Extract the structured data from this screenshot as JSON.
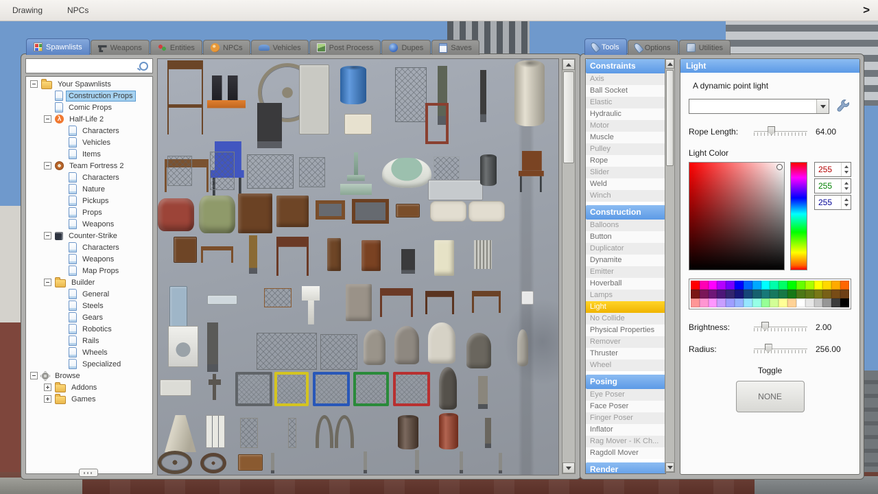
{
  "menubar": {
    "items": [
      "Drawing",
      "NPCs"
    ],
    "chevron": ">"
  },
  "left_tabs": [
    {
      "label": "Spawnlists",
      "icon": "spawnlists",
      "active": true
    },
    {
      "label": "Weapons",
      "icon": "weapons"
    },
    {
      "label": "Entities",
      "icon": "entities"
    },
    {
      "label": "NPCs",
      "icon": "npcs"
    },
    {
      "label": "Vehicles",
      "icon": "vehicles"
    },
    {
      "label": "Post Process",
      "icon": "postprocess"
    },
    {
      "label": "Dupes",
      "icon": "dupes"
    },
    {
      "label": "Saves",
      "icon": "saves"
    }
  ],
  "right_tabs": [
    {
      "label": "Tools",
      "icon": "wrench",
      "active": true
    },
    {
      "label": "Options",
      "icon": "wrench"
    },
    {
      "label": "Utilities",
      "icon": "utilities"
    }
  ],
  "sidebar": {
    "search_value": "",
    "tree": [
      {
        "label": "Your Spawnlists",
        "depth": 0,
        "icon": "folder",
        "expander": "minus"
      },
      {
        "label": "Construction Props",
        "depth": 1,
        "icon": "page",
        "selected": true
      },
      {
        "label": "Comic Props",
        "depth": 1,
        "icon": "page"
      },
      {
        "label": "Half-Life 2",
        "depth": 1,
        "icon": "hl2",
        "expander": "minus"
      },
      {
        "label": "Characters",
        "depth": 2,
        "icon": "page"
      },
      {
        "label": "Vehicles",
        "depth": 2,
        "icon": "page"
      },
      {
        "label": "Items",
        "depth": 2,
        "icon": "page"
      },
      {
        "label": "Team Fortress 2",
        "depth": 1,
        "icon": "tf2",
        "expander": "minus"
      },
      {
        "label": "Characters",
        "depth": 2,
        "icon": "page"
      },
      {
        "label": "Nature",
        "depth": 2,
        "icon": "page"
      },
      {
        "label": "Pickups",
        "depth": 2,
        "icon": "page"
      },
      {
        "label": "Props",
        "depth": 2,
        "icon": "page"
      },
      {
        "label": "Weapons",
        "depth": 2,
        "icon": "page"
      },
      {
        "label": "Counter-Strike",
        "depth": 1,
        "icon": "cs",
        "expander": "minus"
      },
      {
        "label": "Characters",
        "depth": 2,
        "icon": "page"
      },
      {
        "label": "Weapons",
        "depth": 2,
        "icon": "page"
      },
      {
        "label": "Map Props",
        "depth": 2,
        "icon": "page"
      },
      {
        "label": "Builder",
        "depth": 1,
        "icon": "folder",
        "expander": "minus"
      },
      {
        "label": "General",
        "depth": 2,
        "icon": "page"
      },
      {
        "label": "Steels",
        "depth": 2,
        "icon": "page"
      },
      {
        "label": "Gears",
        "depth": 2,
        "icon": "page"
      },
      {
        "label": "Robotics",
        "depth": 2,
        "icon": "page"
      },
      {
        "label": "Rails",
        "depth": 2,
        "icon": "page"
      },
      {
        "label": "Wheels",
        "depth": 2,
        "icon": "page"
      },
      {
        "label": "Specialized",
        "depth": 2,
        "icon": "page"
      },
      {
        "label": "Browse",
        "depth": 0,
        "icon": "gear",
        "expander": "minus"
      },
      {
        "label": "Addons",
        "depth": 1,
        "icon": "folder",
        "expander": "plus"
      },
      {
        "label": "Games",
        "depth": 1,
        "icon": "folder",
        "expander": "plus"
      }
    ]
  },
  "grid": {
    "props": [
      [
        14,
        2,
        52,
        108,
        "stool",
        "#6b4527",
        "prop-bar-stool"
      ],
      [
        72,
        24,
        56,
        48,
        "drums",
        "#2c2c30",
        "prop-drum-dolly"
      ],
      [
        146,
        6,
        86,
        86,
        "wheel",
        "#8d8674",
        "prop-flywheel"
      ],
      [
        206,
        8,
        44,
        102,
        "panel",
        "#c9c9c3",
        "prop-metal-door"
      ],
      [
        266,
        10,
        38,
        56,
        "barrel",
        "#3b82d6",
        "prop-blue-barrel"
      ],
      [
        272,
        80,
        40,
        30,
        "panel",
        "#e7e1cf",
        "prop-counter-shelf"
      ],
      [
        346,
        12,
        46,
        80,
        "fence",
        "#6a7076",
        "prop-barred-window"
      ],
      [
        408,
        10,
        14,
        86,
        "post",
        "#5d6456",
        "prop-gas-cylinder"
      ],
      [
        470,
        16,
        9,
        76,
        "post",
        "#3c3c3c",
        "prop-pipe"
      ],
      [
        520,
        2,
        44,
        96,
        "barrel",
        "#ded8c6",
        "prop-water-heater"
      ],
      [
        10,
        146,
        64,
        48,
        "slab",
        "#7a5230",
        "prop-bench"
      ],
      [
        74,
        120,
        54,
        88,
        "chair",
        "#4156c0",
        "prop-blue-chair"
      ],
      [
        145,
        64,
        36,
        66,
        "post",
        "#3a3a3c",
        "prop-lamp-column"
      ],
      [
        390,
        64,
        34,
        60,
        "frame",
        "#8a4030",
        "prop-door-frame"
      ],
      [
        14,
        141,
        36,
        44,
        "fence",
        "#777d82",
        "prop-fence-small"
      ],
      [
        76,
        135,
        36,
        56,
        "fence",
        "#777d82",
        "prop-fence-tall"
      ],
      [
        130,
        139,
        68,
        50,
        "fence",
        "#6d7378",
        "prop-gate-wide"
      ],
      [
        206,
        143,
        38,
        44,
        "fence",
        "#777d82",
        "prop-fence-panel-a"
      ],
      [
        266,
        136,
        46,
        62,
        "fountain",
        "#8aa694",
        "prop-fountain"
      ],
      [
        327,
        144,
        72,
        44,
        "tub",
        "#eef0e8",
        "prop-bathtub"
      ],
      [
        402,
        142,
        38,
        40,
        "fence",
        "#9aa0a6",
        "prop-bed-frame"
      ],
      [
        394,
        176,
        80,
        30,
        "panel",
        "#c6cacd",
        "prop-barrier"
      ],
      [
        470,
        139,
        24,
        46,
        "barrel",
        "#4a4e50",
        "prop-trash-can"
      ],
      [
        524,
        134,
        40,
        60,
        "chair",
        "#7a4423",
        "prop-wood-chair"
      ],
      [
        0,
        203,
        53,
        48,
        "couch",
        "#9c4438",
        "prop-red-couch"
      ],
      [
        60,
        199,
        53,
        55,
        "couch",
        "#8f9a6a",
        "prop-green-couch"
      ],
      [
        117,
        196,
        50,
        58,
        "box",
        "#6b4224",
        "prop-armoire"
      ],
      [
        173,
        199,
        47,
        46,
        "box",
        "#6e4526",
        "prop-dresser"
      ],
      [
        230,
        206,
        43,
        28,
        "tray",
        "#7a4e2a",
        "prop-crate-tray"
      ],
      [
        283,
        204,
        54,
        36,
        "tray",
        "#6b4022",
        "prop-crate-tray-2"
      ],
      [
        347,
        211,
        35,
        20,
        "panel",
        "#7a4e2a",
        "prop-board"
      ],
      [
        397,
        207,
        53,
        30,
        "mattress",
        "#e2ddd0",
        "prop-mattress"
      ],
      [
        453,
        207,
        53,
        30,
        "mattress",
        "#e2ddd0",
        "prop-mattress-2"
      ],
      [
        23,
        259,
        34,
        38,
        "panel",
        "#6e4526",
        "prop-headboard"
      ],
      [
        63,
        273,
        47,
        24,
        "slab",
        "#7a4e2a",
        "prop-coffee-table"
      ],
      [
        133,
        257,
        12,
        56,
        "post",
        "#8a6a34",
        "prop-flag-pole"
      ],
      [
        173,
        259,
        47,
        57,
        "slab",
        "#6b3a26",
        "prop-desk"
      ],
      [
        247,
        261,
        20,
        48,
        "box",
        "#6e4526",
        "prop-tall-cabinet"
      ],
      [
        297,
        264,
        28,
        45,
        "box",
        "#7a4222",
        "prop-cabinet"
      ],
      [
        355,
        277,
        20,
        36,
        "post",
        "#3a3a3c",
        "prop-stove"
      ],
      [
        403,
        264,
        29,
        52,
        "box",
        "#e6e2c6",
        "prop-fridge"
      ],
      [
        461,
        264,
        26,
        42,
        "radiator",
        "#c9c9c3",
        "prop-radiator"
      ],
      [
        17,
        331,
        26,
        60,
        "panel",
        "#9fb6c8",
        "prop-glass-door"
      ],
      [
        72,
        344,
        44,
        14,
        "panel",
        "#cfd8dd",
        "prop-glass-pane"
      ],
      [
        155,
        334,
        40,
        28,
        "fence",
        "#8a5a30",
        "prop-coat-rack"
      ],
      [
        210,
        331,
        26,
        56,
        "sink",
        "#e8e8e4",
        "prop-sink"
      ],
      [
        274,
        328,
        38,
        54,
        "box",
        "#9a9288",
        "prop-filing-cabinet"
      ],
      [
        324,
        334,
        48,
        42,
        "slab",
        "#6b3a26",
        "prop-round-table"
      ],
      [
        390,
        338,
        42,
        34,
        "slab",
        "#5a3420",
        "prop-table"
      ],
      [
        458,
        338,
        42,
        32,
        "slab",
        "#6b4226",
        "prop-table-2"
      ],
      [
        530,
        338,
        18,
        20,
        "panel",
        "#e8e8e8",
        "prop-paper"
      ],
      [
        15,
        389,
        44,
        60,
        "washer",
        "#e0e0da",
        "prop-washer"
      ],
      [
        72,
        384,
        16,
        72,
        "post",
        "#5a5a58",
        "prop-street-lamp"
      ],
      [
        144,
        399,
        88,
        54,
        "fence",
        "#707478",
        "prop-gate-fence"
      ],
      [
        237,
        401,
        54,
        52,
        "fence",
        "#707478",
        "prop-fence-panel-b"
      ],
      [
        300,
        394,
        32,
        52,
        "stone",
        "#9a948a",
        "prop-gravestone-1"
      ],
      [
        345,
        389,
        36,
        56,
        "stone",
        "#8e8880",
        "prop-gravestone-2"
      ],
      [
        394,
        384,
        40,
        60,
        "stone",
        "#d6d2c6",
        "prop-gravestone-3"
      ],
      [
        450,
        399,
        36,
        52,
        "stone",
        "#6a665e",
        "prop-gravestone-4"
      ],
      [
        524,
        394,
        16,
        54,
        "stone",
        "#a8a49a",
        "prop-grave-marker"
      ],
      [
        3,
        467,
        46,
        24,
        "panel",
        "#dcdcd6",
        "prop-white-box"
      ],
      [
        74,
        459,
        18,
        38,
        "cross",
        "#5a5650",
        "prop-cross-marker"
      ],
      [
        113,
        456,
        54,
        50,
        "cage",
        "#606468",
        "prop-cage-gray"
      ],
      [
        170,
        456,
        50,
        50,
        "cage",
        "#d4c420",
        "prop-cage-yellow"
      ],
      [
        226,
        456,
        54,
        50,
        "cage",
        "#2857b8",
        "prop-cage-blue"
      ],
      [
        285,
        456,
        52,
        50,
        "cage",
        "#2a8a3a",
        "prop-cage-green"
      ],
      [
        343,
        456,
        54,
        50,
        "cage",
        "#b83030",
        "prop-cage-red"
      ],
      [
        410,
        449,
        26,
        62,
        "stone",
        "#55514b",
        "prop-obelisk"
      ],
      [
        467,
        462,
        14,
        48,
        "post",
        "#8a867c",
        "prop-statue"
      ],
      [
        10,
        519,
        46,
        54,
        "cone",
        "#ccc6b2",
        "prop-lamp-shade"
      ],
      [
        70,
        519,
        28,
        48,
        "lockers",
        "#e8e8e2",
        "prop-lockers"
      ],
      [
        120,
        523,
        26,
        44,
        "fence",
        "#8a8a86",
        "prop-scaffold-1"
      ],
      [
        190,
        523,
        12,
        44,
        "fence",
        "#8a8a86",
        "prop-scaffold-2"
      ],
      [
        230,
        519,
        26,
        48,
        "faucet",
        "#6e6a60",
        "prop-faucet-1"
      ],
      [
        258,
        519,
        28,
        48,
        "faucet",
        "#6e6a60",
        "prop-faucet-2"
      ],
      [
        350,
        519,
        30,
        50,
        "barrel",
        "#5a4436",
        "prop-rust-barrel"
      ],
      [
        410,
        516,
        28,
        53,
        "barrel",
        "#9e3e26",
        "prop-red-barrel"
      ],
      [
        477,
        523,
        9,
        44,
        "post",
        "#6a665e",
        "prop-hook-pole"
      ],
      [
        0,
        571,
        50,
        34,
        "wheel",
        "#5a4a3a",
        "prop-wheel-part"
      ],
      [
        62,
        574,
        38,
        30,
        "wheel",
        "#5a4434",
        "prop-gear-part"
      ],
      [
        117,
        576,
        36,
        24,
        "panel",
        "#8a5a30",
        "prop-plank"
      ],
      [
        165,
        574,
        5,
        30,
        "post",
        "#8a8a86",
        "prop-pole-1"
      ],
      [
        300,
        572,
        5,
        32,
        "post",
        "#8a8a86",
        "prop-pole-2"
      ],
      [
        375,
        570,
        6,
        34,
        "post",
        "#8a8a86",
        "prop-pole-3"
      ],
      [
        440,
        572,
        5,
        32,
        "post",
        "#8a8a86",
        "prop-pole-4"
      ],
      [
        497,
        574,
        5,
        30,
        "post",
        "#8a8a86",
        "prop-pole-5"
      ]
    ]
  },
  "tools_panel": {
    "sections": [
      {
        "header": "Constraints",
        "items": [
          "Axis",
          "Ball Socket",
          "Elastic",
          "Hydraulic",
          "Motor",
          "Muscle",
          "Pulley",
          "Rope",
          "Slider",
          "Weld",
          "Winch"
        ]
      },
      {
        "header": "Construction",
        "selected": "Light",
        "items": [
          "Balloons",
          "Button",
          "Duplicator",
          "Dynamite",
          "Emitter",
          "Hoverball",
          "Lamps",
          "Light",
          "No Collide",
          "Physical Properties",
          "Remover",
          "Thruster",
          "Wheel"
        ]
      },
      {
        "header": "Posing",
        "items": [
          "Eye Poser",
          "Face Poser",
          "Finger Poser",
          "Inflator",
          "Rag Mover - IK Ch...",
          "Ragdoll Mover"
        ]
      },
      {
        "header": "Render",
        "items": []
      }
    ]
  },
  "light_panel": {
    "title": "Light",
    "description": "A dynamic point light",
    "preset_value": "",
    "rope_label": "Rope Length:",
    "rope_value": "64.00",
    "color_label": "Light Color",
    "rgb": [
      {
        "channel": "red",
        "value": "255",
        "color": "#b40000"
      },
      {
        "channel": "green",
        "value": "255",
        "color": "#008000"
      },
      {
        "channel": "blue",
        "value": "255",
        "color": "#000096"
      }
    ],
    "palette_rows": [
      [
        "#ff0000",
        "#ff00b4",
        "#ff00ff",
        "#b400ff",
        "#7800ff",
        "#0000ff",
        "#0064ff",
        "#00a8ff",
        "#00ffff",
        "#00ffaa",
        "#00ff66",
        "#00ff00",
        "#66ff00",
        "#aaff00",
        "#ffff00",
        "#ffd800",
        "#ffaa00",
        "#ff6600"
      ],
      [
        "#7a1616",
        "#7a1658",
        "#6e1678",
        "#4c1678",
        "#32246e",
        "#161678",
        "#164678",
        "#16606e",
        "#167878",
        "#16785e",
        "#167846",
        "#167816",
        "#4c7816",
        "#5e7816",
        "#787816",
        "#786016",
        "#784c16",
        "#6e4016"
      ],
      [
        "#ff9696",
        "#ff96d2",
        "#ff96ff",
        "#c89eff",
        "#9e9eff",
        "#96b4ff",
        "#96e6ff",
        "#96ffe6",
        "#96ff96",
        "#d2ff96",
        "#ffff96",
        "#ffd296",
        "#ffffff",
        "#e6e6e6",
        "#c8c8c8",
        "#969696",
        "#3c3c3c",
        "#000000"
      ]
    ],
    "brightness_label": "Brightness:",
    "brightness_value": "2.00",
    "radius_label": "Radius:",
    "radius_value": "256.00",
    "toggle_label": "Toggle",
    "none_label": "NONE"
  }
}
